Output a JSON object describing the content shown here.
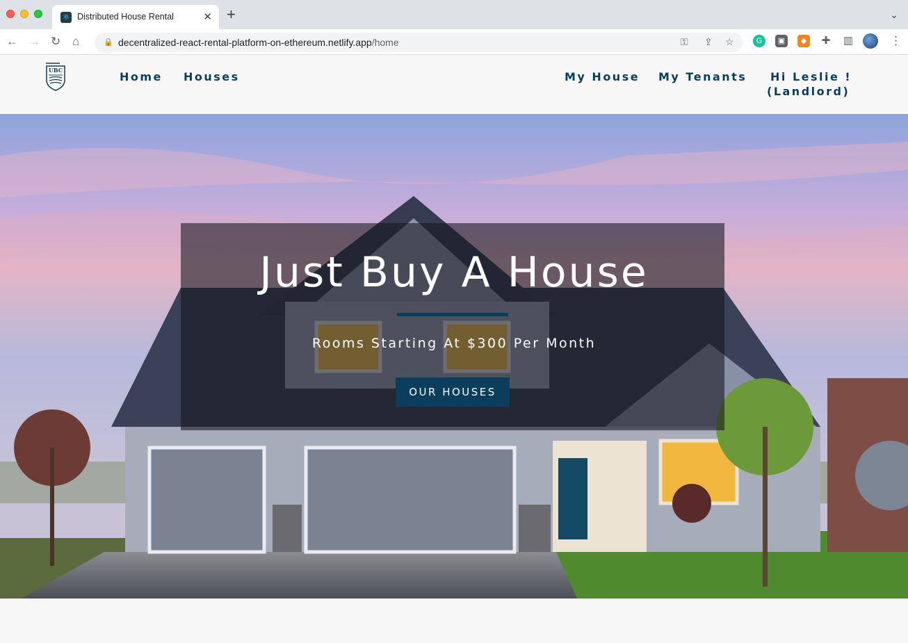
{
  "browser": {
    "tab_title": "Distributed House Rental",
    "url_host": "decentralized-react-rental-platform-on-ethereum.netlify.app",
    "url_path": "/home",
    "icons": [
      "back-icon",
      "forward-icon",
      "reload-icon",
      "home-icon",
      "lock-icon",
      "key-icon",
      "share-icon",
      "star-icon",
      "grammarly-icon",
      "extension-icon",
      "metamask-icon",
      "puzzle-icon",
      "sidepanel-icon",
      "profile-avatar",
      "menu-icon"
    ]
  },
  "nav": {
    "logo_alt": "UBC",
    "links": {
      "home": "Home",
      "houses": "Houses",
      "my_house": "My House",
      "my_tenants": "My Tenants"
    },
    "greeting_line1": "Hi Leslie !",
    "greeting_line2": "(Landlord)"
  },
  "hero": {
    "title": "Just Buy A House",
    "subtitle": "Rooms Starting At $300 Per Month",
    "button_label": "OUR HOUSES"
  },
  "colors": {
    "brand": "#0b3d5c",
    "page_bg": "#f7f7f7",
    "overlay": "rgba(20,22,30,0.58)"
  }
}
